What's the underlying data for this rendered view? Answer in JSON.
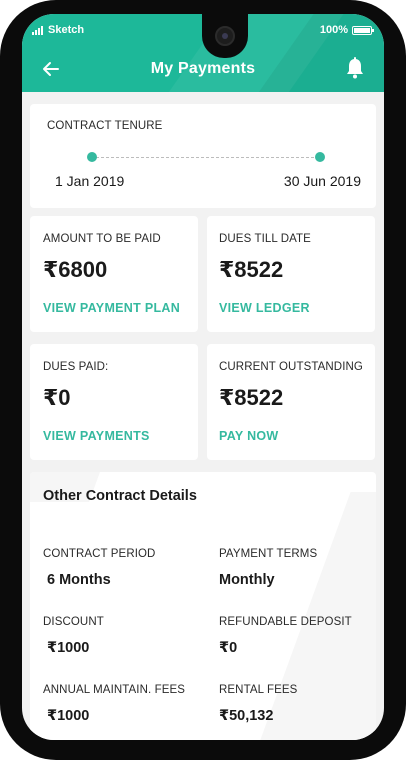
{
  "status_bar": {
    "carrier": "Sketch",
    "battery": "100%"
  },
  "header": {
    "title": "My Payments",
    "back_icon": "arrow-left-icon",
    "notification_icon": "bell-icon"
  },
  "colors": {
    "accent": "#1db899",
    "link": "#35b99f",
    "background": "#f2f2f2"
  },
  "tenure": {
    "label": "CONTRACT TENURE",
    "start_date": "1 Jan 2019",
    "end_date": "30 Jun 2019"
  },
  "summary_cards": [
    {
      "label": "AMOUNT TO BE PAID",
      "amount": "₹6800",
      "link": "VIEW PAYMENT PLAN"
    },
    {
      "label": "DUES TILL DATE",
      "amount": "₹8522",
      "link": "VIEW LEDGER"
    },
    {
      "label": "DUES PAID:",
      "amount": "₹0",
      "link": "VIEW PAYMENTS"
    },
    {
      "label": "CURRENT OUTSTANDING",
      "amount": "₹8522",
      "link": "PAY NOW"
    }
  ],
  "details": {
    "title": "Other Contract Details",
    "items": [
      {
        "label": "CONTRACT PERIOD",
        "value": "6 Months"
      },
      {
        "label": "PAYMENT TERMS",
        "value": "Monthly"
      },
      {
        "label": "DISCOUNT",
        "value": "₹1000"
      },
      {
        "label": "REFUNDABLE DEPOSIT",
        "value": "₹0"
      },
      {
        "label": "ANNUAL MAINTAIN. FEES",
        "value": "₹1000"
      },
      {
        "label": "RENTAL FEES",
        "value": "₹50,132"
      }
    ]
  }
}
